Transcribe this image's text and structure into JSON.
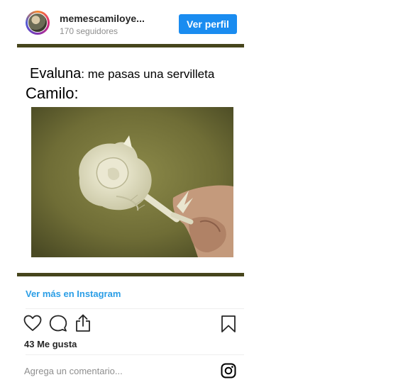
{
  "header": {
    "username": "memescamiloye...",
    "followers": "170 seguidores",
    "profile_button": "Ver perfil"
  },
  "meme": {
    "line1_name": "Evaluna",
    "line1_text": ": me pasas una servilleta",
    "line2": "Camilo:"
  },
  "links": {
    "view_more": "Ver más en Instagram"
  },
  "actions": {
    "likes": "43 Me gusta"
  },
  "comment": {
    "placeholder": "Agrega un comentario..."
  },
  "icons": [
    "heart-icon",
    "comment-icon",
    "share-icon",
    "bookmark-icon",
    "instagram-icon"
  ],
  "colors": {
    "button": "#1a8cf0",
    "link": "#2b9ee6",
    "meme_bar": "#46451c"
  }
}
